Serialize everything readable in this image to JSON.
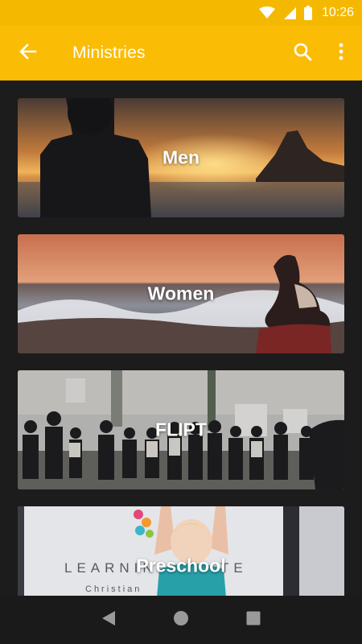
{
  "status_bar": {
    "time": "10:26",
    "icons": [
      "wifi-icon",
      "signal-icon",
      "battery-icon"
    ]
  },
  "app_bar": {
    "title": "Ministries",
    "back_icon": "arrow-back-icon",
    "actions": [
      "search-icon",
      "more-vert-icon"
    ],
    "color": "#fbbc05"
  },
  "ministries": [
    {
      "label": "Men"
    },
    {
      "label": "Women"
    },
    {
      "label": "FLIPT"
    },
    {
      "label": "Preschool"
    }
  ],
  "nav_bar": {
    "buttons": [
      "back-triangle-icon",
      "home-circle-icon",
      "recents-square-icon"
    ]
  }
}
